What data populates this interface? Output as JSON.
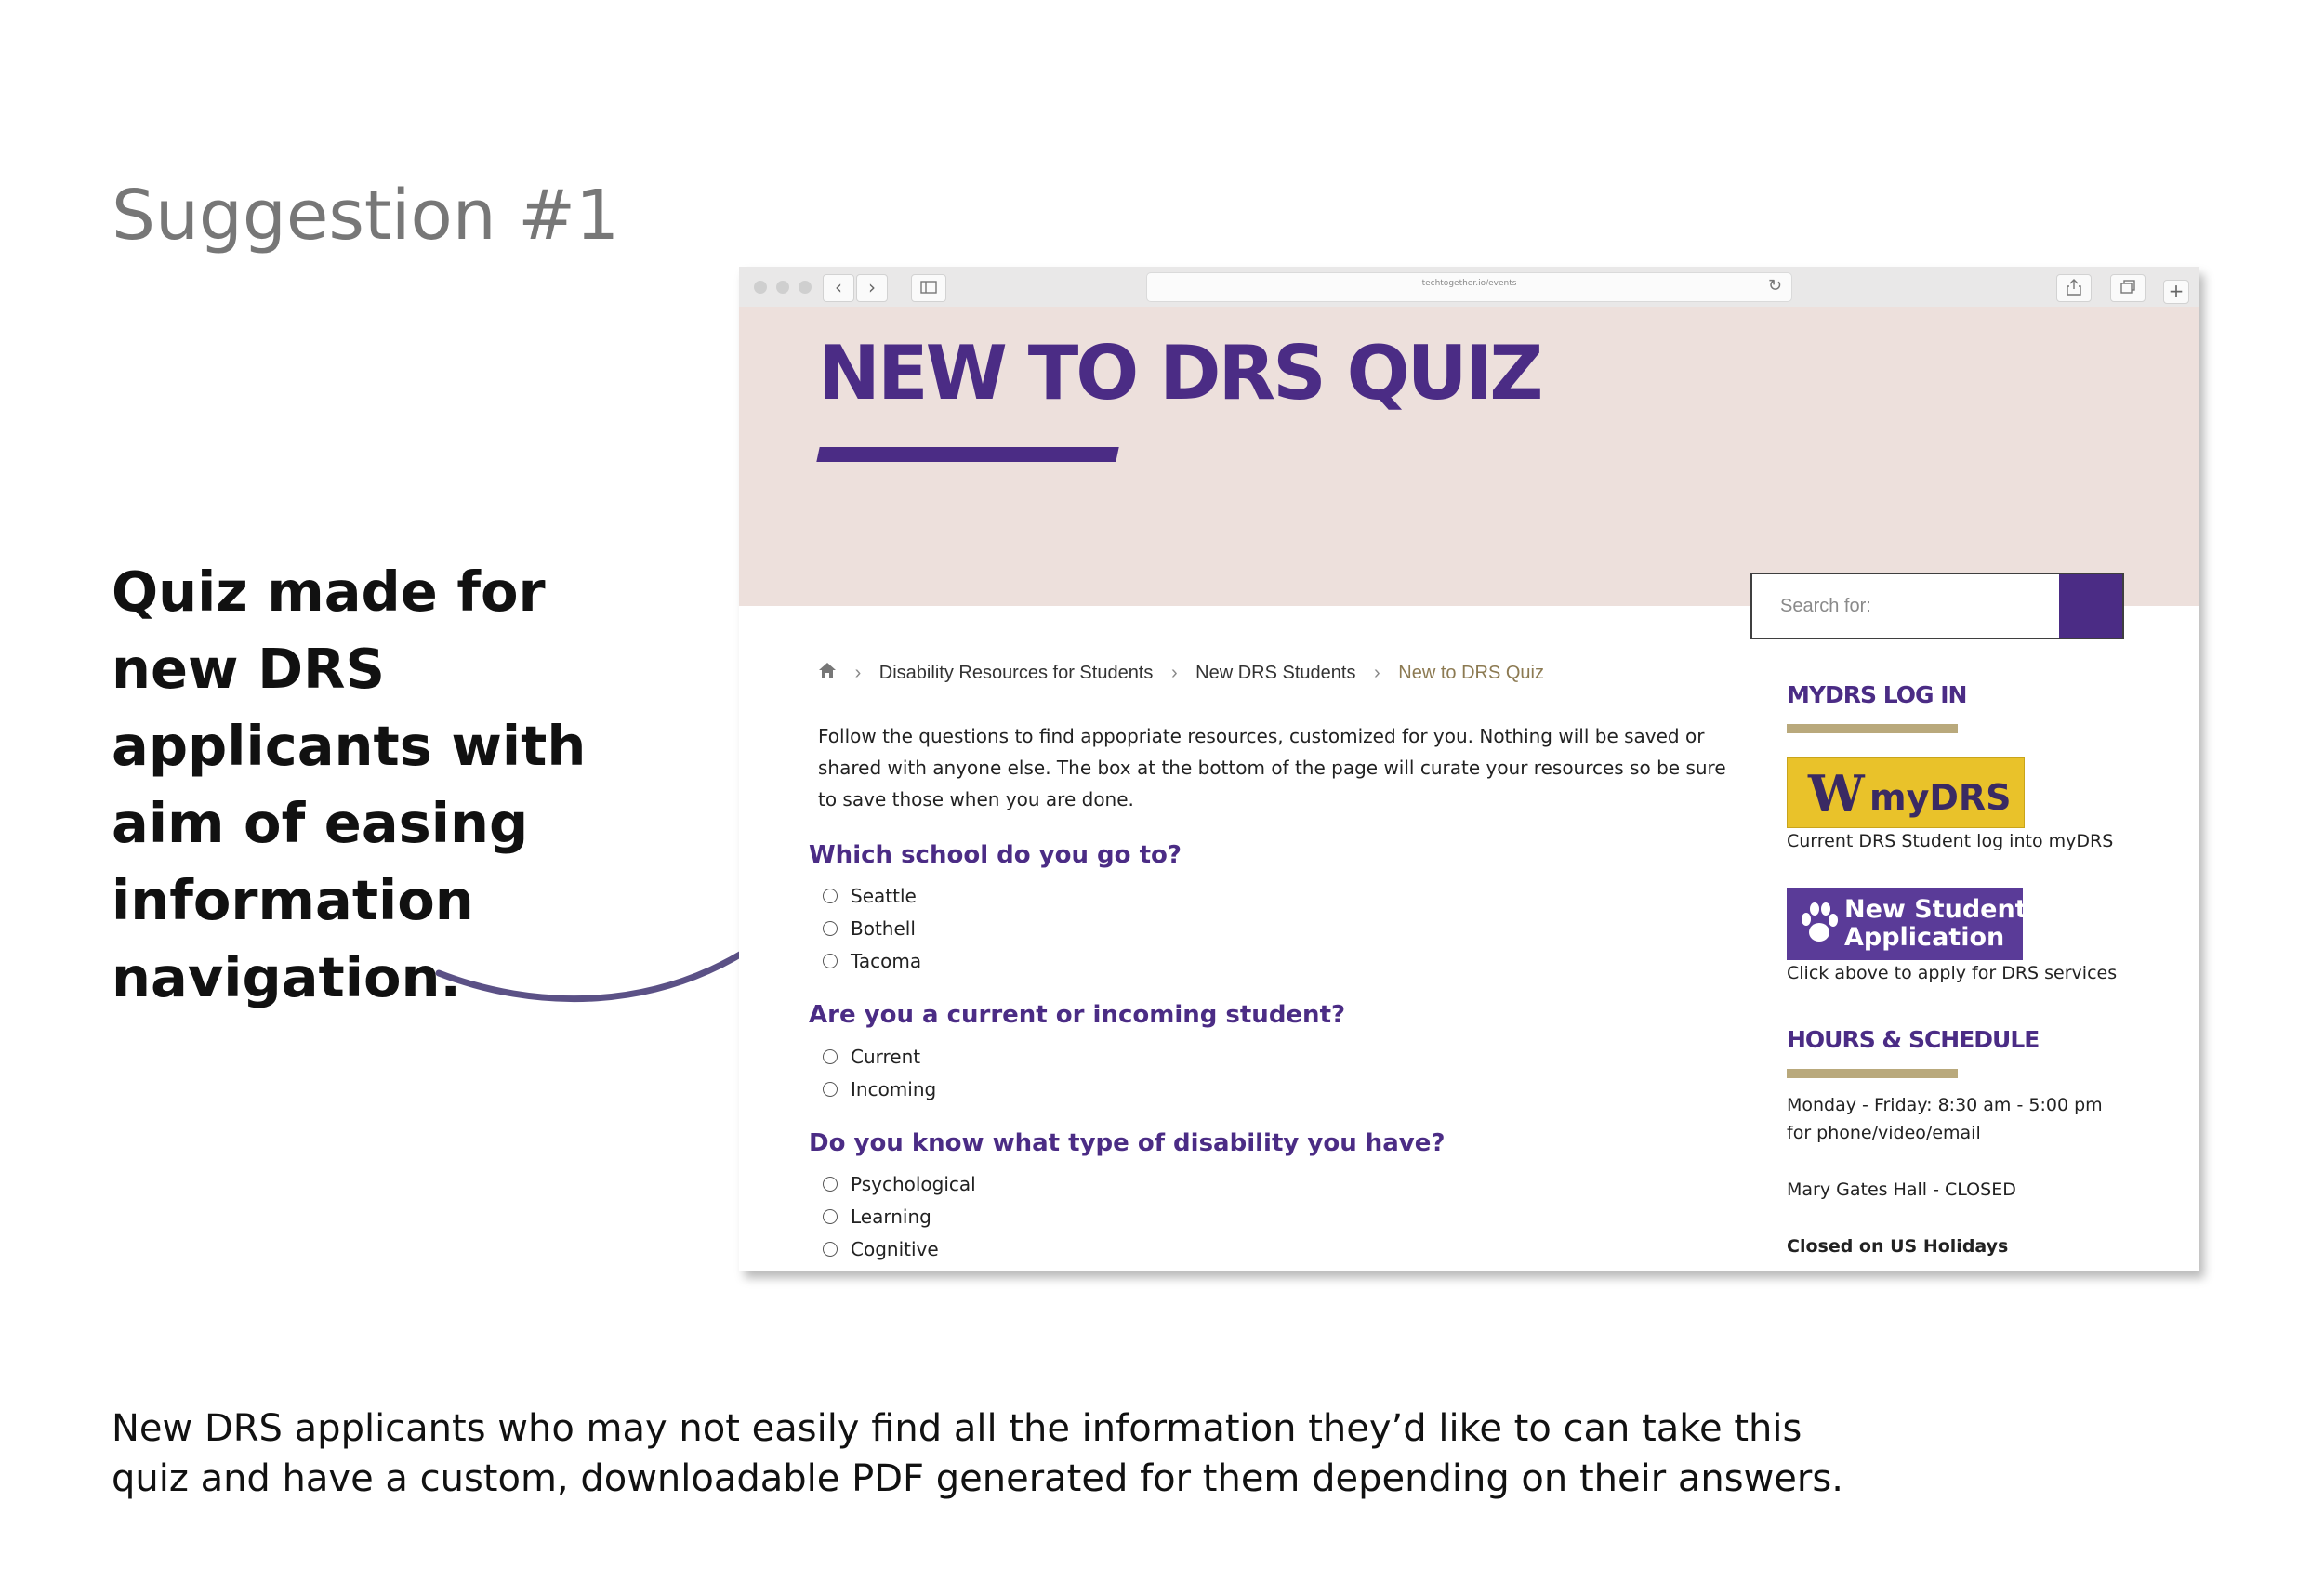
{
  "slide": {
    "title": "Suggestion #1",
    "annotation": "Quiz made for new DRS applicants with aim of easing information navigation.",
    "description": "New DRS applicants who may not easily find all the information they’d like to can take this quiz and have a custom, downloadable PDF generated for them depending on their answers."
  },
  "browser": {
    "url": "techtogether.io/events"
  },
  "page": {
    "hero_title": "NEW TO DRS QUIZ",
    "search": {
      "placeholder": "Search for:"
    },
    "breadcrumb": {
      "items": [
        "Disability Resources for Students",
        "New DRS Students"
      ],
      "current": "New to DRS Quiz"
    },
    "intro": "Follow the questions to find appopriate resources, customized for you. Nothing will be saved or shared with anyone else. The box at the bottom of the page will curate your resources so be sure to save those when you are done.",
    "questions": [
      {
        "label": "Which school do you go to?",
        "options": [
          "Seattle",
          "Bothell",
          "Tacoma"
        ]
      },
      {
        "label": "Are you a current or incoming student?",
        "options": [
          "Current",
          "Incoming"
        ]
      },
      {
        "label": "Do you know what type of disability you have?",
        "options": [
          "Psychological",
          "Learning",
          "Cognitive"
        ]
      }
    ],
    "sidebar": {
      "login_heading": "MYDRS LOG IN",
      "mydrs_button": {
        "mark": "W",
        "label": "myDRS"
      },
      "mydrs_caption": "Current DRS Student log into myDRS",
      "apply_button": {
        "line1": "New Student",
        "line2": "Application"
      },
      "apply_caption": "Click above to apply for DRS services",
      "hours_heading": "HOURS & SCHEDULE",
      "hours_line1": "Monday - Friday: 8:30 am - 5:00 pm",
      "hours_line2": "for phone/video/email",
      "location": "Mary Gates Hall - CLOSED",
      "holidays": "Closed on US Holidays"
    }
  },
  "colors": {
    "brand_purple": "#4b2c85",
    "gold_rule": "#b9a97c",
    "hero_bg": "#ede0dc",
    "mydrs_gold": "#e9c22a"
  }
}
